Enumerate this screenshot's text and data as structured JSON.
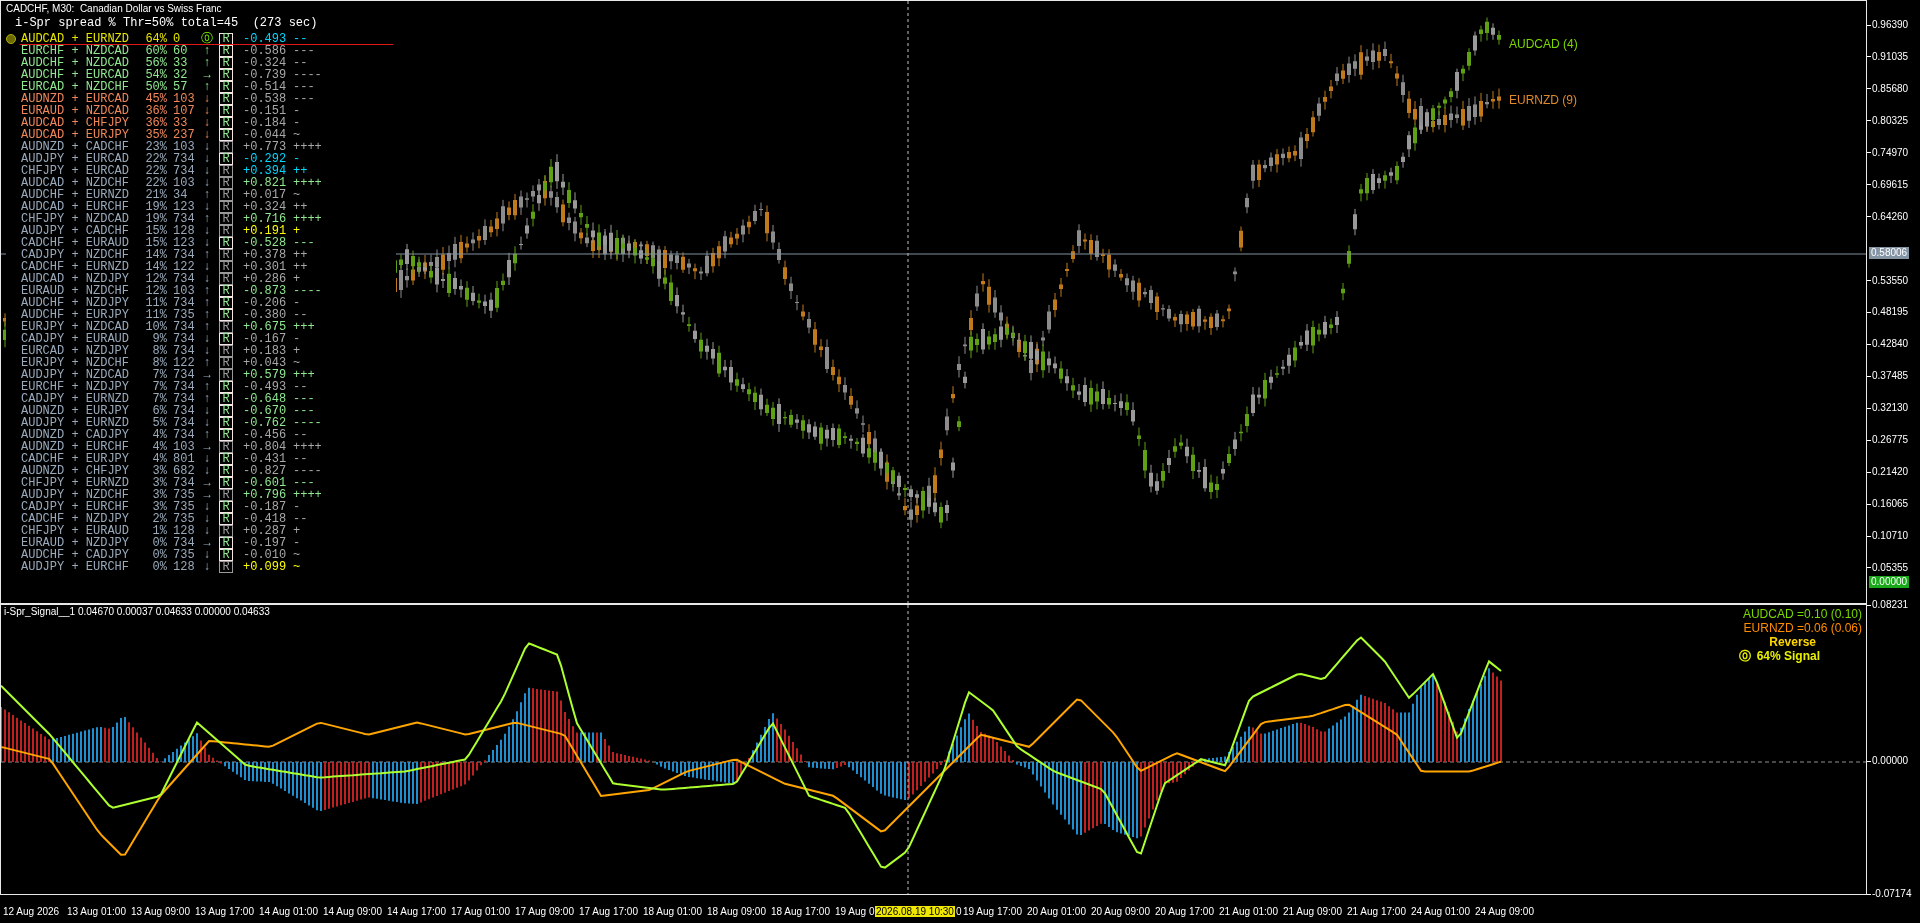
{
  "chart_title": "CADCHF, M30:  Canadian Dollar vs Swiss Franc",
  "panel_heading": "i-Spr spread % Thr=50% total=45  (273 sec)",
  "pairs": [
    {
      "pair": "AUDCAD + EURNZD",
      "percent": "64%",
      "count": "0",
      "direction": "⓪",
      "flag": "R",
      "flag_active": true,
      "value": {
        "text": "-0.493",
        "color": "#00d8ff"
      },
      "trend": "--",
      "color": "#e6e600",
      "selected": true
    },
    {
      "pair": "EURCHF + NZDCAD",
      "percent": "60%",
      "count": "60",
      "direction": "↑",
      "flag": "R",
      "flag_active": true,
      "value": {
        "text": "-0.586",
        "color": "#a8a8a8"
      },
      "trend": "---",
      "color": "#90e890",
      "selected": false
    },
    {
      "pair": "AUDCHF + NZDCAD",
      "percent": "56%",
      "count": "33",
      "direction": "↑",
      "flag": "R",
      "flag_active": true,
      "value": {
        "text": "-0.324",
        "color": "#a8a8a8"
      },
      "trend": "--",
      "color": "#90e890",
      "selected": false
    },
    {
      "pair": "AUDCHF + EURCAD",
      "percent": "54%",
      "count": "32",
      "direction": "→",
      "flag": "R",
      "flag_active": true,
      "value": {
        "text": "-0.739",
        "color": "#a8a8a8"
      },
      "trend": "----",
      "color": "#90e890",
      "selected": false
    },
    {
      "pair": "EURCAD + NZDCHF",
      "percent": "50%",
      "count": "57",
      "direction": "↑",
      "flag": "R",
      "flag_active": true,
      "value": {
        "text": "-0.514",
        "color": "#a8a8a8"
      },
      "trend": "---",
      "color": "#90e890",
      "selected": false
    },
    {
      "pair": "AUDNZD + EURCAD",
      "percent": "45%",
      "count": "103",
      "direction": "↓",
      "flag": "R",
      "flag_active": true,
      "value": {
        "text": "-0.538",
        "color": "#a8a8a8"
      },
      "trend": "---",
      "color": "#f0875a",
      "selected": false
    },
    {
      "pair": "EURAUD + NZDCAD",
      "percent": "36%",
      "count": "107",
      "direction": "↓",
      "flag": "R",
      "flag_active": true,
      "value": {
        "text": "-0.151",
        "color": "#a8a8a8"
      },
      "trend": "-",
      "color": "#f0875a",
      "selected": false
    },
    {
      "pair": "AUDCAD + CHFJPY",
      "percent": "36%",
      "count": "33",
      "direction": "↓",
      "flag": "R",
      "flag_active": true,
      "value": {
        "text": "-0.184",
        "color": "#a8a8a8"
      },
      "trend": "-",
      "color": "#f0875a",
      "selected": false
    },
    {
      "pair": "AUDCAD + EURJPY",
      "percent": "35%",
      "count": "237",
      "direction": "↓",
      "flag": "R",
      "flag_active": true,
      "value": {
        "text": "-0.044",
        "color": "#a8a8a8"
      },
      "trend": "~",
      "color": "#f0875a",
      "selected": false
    },
    {
      "pair": "AUDNZD + CADCHF",
      "percent": "23%",
      "count": "103",
      "direction": "↓",
      "flag": "R",
      "flag_active": false,
      "value": {
        "text": "+0.773",
        "color": "#a8a8a8"
      },
      "trend": "++++",
      "color": "#9aaabb",
      "selected": false
    },
    {
      "pair": "AUDJPY + EURCAD",
      "percent": "22%",
      "count": "734",
      "direction": "↓",
      "flag": "R",
      "flag_active": true,
      "value": {
        "text": "-0.292",
        "color": "#00d8ff"
      },
      "trend": "-",
      "color": "#9aaabb",
      "selected": false
    },
    {
      "pair": "CHFJPY + EURCAD",
      "percent": "22%",
      "count": "734",
      "direction": "↓",
      "flag": "R",
      "flag_active": false,
      "value": {
        "text": "+0.394",
        "color": "#00d8ff"
      },
      "trend": "++",
      "color": "#9aaabb",
      "selected": false
    },
    {
      "pair": "AUDCAD + NZDCHF",
      "percent": "22%",
      "count": "103",
      "direction": "↓",
      "flag": "R",
      "flag_active": false,
      "value": {
        "text": "+0.821",
        "color": "#90e890"
      },
      "trend": "++++",
      "color": "#9aaabb",
      "selected": false
    },
    {
      "pair": "AUDCHF + EURNZD",
      "percent": "21%",
      "count": "34",
      "direction": "↑",
      "flag": "R",
      "flag_active": false,
      "value": {
        "text": "+0.017",
        "color": "#a8a8a8"
      },
      "trend": "~",
      "color": "#9aaabb",
      "selected": false
    },
    {
      "pair": "AUDCAD + EURCHF",
      "percent": "19%",
      "count": "123",
      "direction": "↓",
      "flag": "R",
      "flag_active": false,
      "value": {
        "text": "+0.324",
        "color": "#a8a8a8"
      },
      "trend": "++",
      "color": "#9aaabb",
      "selected": false
    },
    {
      "pair": "CHFJPY + NZDCAD",
      "percent": "19%",
      "count": "734",
      "direction": "↑",
      "flag": "R",
      "flag_active": false,
      "value": {
        "text": "+0.716",
        "color": "#90e890"
      },
      "trend": "++++",
      "color": "#9aaabb",
      "selected": false
    },
    {
      "pair": "AUDJPY + CADCHF",
      "percent": "15%",
      "count": "128",
      "direction": "↓",
      "flag": "R",
      "flag_active": false,
      "value": {
        "text": "+0.191",
        "color": "#ffff00"
      },
      "trend": "+",
      "color": "#9aaabb",
      "selected": false
    },
    {
      "pair": "CADCHF + EURAUD",
      "percent": "15%",
      "count": "123",
      "direction": "↓",
      "flag": "R",
      "flag_active": true,
      "value": {
        "text": "-0.528",
        "color": "#90e890"
      },
      "trend": "---",
      "color": "#9aaabb",
      "selected": false
    },
    {
      "pair": "CADJPY + NZDCHF",
      "percent": "14%",
      "count": "734",
      "direction": "↑",
      "flag": "R",
      "flag_active": false,
      "value": {
        "text": "+0.378",
        "color": "#a8a8a8"
      },
      "trend": "++",
      "color": "#9aaabb",
      "selected": false
    },
    {
      "pair": "CADCHF + EURNZD",
      "percent": "14%",
      "count": "122",
      "direction": "↓",
      "flag": "R",
      "flag_active": false,
      "value": {
        "text": "+0.301",
        "color": "#a8a8a8"
      },
      "trend": "++",
      "color": "#9aaabb",
      "selected": false
    },
    {
      "pair": "AUDCAD + NZDJPY",
      "percent": "12%",
      "count": "734",
      "direction": "↓",
      "flag": "R",
      "flag_active": false,
      "value": {
        "text": "+0.286",
        "color": "#a8a8a8"
      },
      "trend": "+",
      "color": "#9aaabb",
      "selected": false
    },
    {
      "pair": "EURAUD + NZDCHF",
      "percent": "12%",
      "count": "103",
      "direction": "↑",
      "flag": "R",
      "flag_active": true,
      "value": {
        "text": "-0.873",
        "color": "#90e890"
      },
      "trend": "----",
      "color": "#9aaabb",
      "selected": false
    },
    {
      "pair": "AUDCHF + NZDJPY",
      "percent": "11%",
      "count": "734",
      "direction": "↑",
      "flag": "R",
      "flag_active": true,
      "value": {
        "text": "-0.206",
        "color": "#a8a8a8"
      },
      "trend": "-",
      "color": "#9aaabb",
      "selected": false
    },
    {
      "pair": "AUDCHF + EURJPY",
      "percent": "11%",
      "count": "735",
      "direction": "↑",
      "flag": "R",
      "flag_active": true,
      "value": {
        "text": "-0.380",
        "color": "#a8a8a8"
      },
      "trend": "--",
      "color": "#9aaabb",
      "selected": false
    },
    {
      "pair": "EURJPY + NZDCAD",
      "percent": "10%",
      "count": "734",
      "direction": "↑",
      "flag": "R",
      "flag_active": false,
      "value": {
        "text": "+0.675",
        "color": "#90e890"
      },
      "trend": "+++",
      "color": "#9aaabb",
      "selected": false
    },
    {
      "pair": "CADJPY + EURAUD",
      "percent": "9%",
      "count": "734",
      "direction": "↓",
      "flag": "R",
      "flag_active": true,
      "value": {
        "text": "-0.167",
        "color": "#a8a8a8"
      },
      "trend": "-",
      "color": "#9aaabb",
      "selected": false
    },
    {
      "pair": "EURCAD + NZDJPY",
      "percent": "8%",
      "count": "734",
      "direction": "↓",
      "flag": "R",
      "flag_active": false,
      "value": {
        "text": "+0.183",
        "color": "#a8a8a8"
      },
      "trend": "+",
      "color": "#9aaabb",
      "selected": false
    },
    {
      "pair": "EURJPY + NZDCHF",
      "percent": "8%",
      "count": "122",
      "direction": "↑",
      "flag": "R",
      "flag_active": false,
      "value": {
        "text": "+0.043",
        "color": "#a8a8a8"
      },
      "trend": "~",
      "color": "#9aaabb",
      "selected": false
    },
    {
      "pair": "AUDJPY + NZDCAD",
      "percent": "7%",
      "count": "734",
      "direction": "→",
      "flag": "R",
      "flag_active": false,
      "value": {
        "text": "+0.579",
        "color": "#90e890"
      },
      "trend": "+++",
      "color": "#9aaabb",
      "selected": false
    },
    {
      "pair": "EURCHF + NZDJPY",
      "percent": "7%",
      "count": "734",
      "direction": "↑",
      "flag": "R",
      "flag_active": true,
      "value": {
        "text": "-0.493",
        "color": "#a8a8a8"
      },
      "trend": "--",
      "color": "#9aaabb",
      "selected": false
    },
    {
      "pair": "CADJPY + EURNZD",
      "percent": "7%",
      "count": "734",
      "direction": "↑",
      "flag": "R",
      "flag_active": true,
      "value": {
        "text": "-0.648",
        "color": "#90e890"
      },
      "trend": "---",
      "color": "#9aaabb",
      "selected": false
    },
    {
      "pair": "AUDNZD + EURJPY",
      "percent": "6%",
      "count": "734",
      "direction": "↓",
      "flag": "R",
      "flag_active": true,
      "value": {
        "text": "-0.670",
        "color": "#90e890"
      },
      "trend": "---",
      "color": "#9aaabb",
      "selected": false
    },
    {
      "pair": "AUDJPY + EURNZD",
      "percent": "5%",
      "count": "734",
      "direction": "↓",
      "flag": "R",
      "flag_active": true,
      "value": {
        "text": "-0.762",
        "color": "#90e890"
      },
      "trend": "----",
      "color": "#9aaabb",
      "selected": false
    },
    {
      "pair": "AUDNZD + CADJPY",
      "percent": "4%",
      "count": "734",
      "direction": "↑",
      "flag": "R",
      "flag_active": true,
      "value": {
        "text": "-0.456",
        "color": "#a8a8a8"
      },
      "trend": "--",
      "color": "#9aaabb",
      "selected": false
    },
    {
      "pair": "AUDNZD + EURCHF",
      "percent": "4%",
      "count": "103",
      "direction": "→",
      "flag": "R",
      "flag_active": false,
      "value": {
        "text": "+0.804",
        "color": "#a8a8a8"
      },
      "trend": "++++",
      "color": "#9aaabb",
      "selected": false
    },
    {
      "pair": "CADCHF + EURJPY",
      "percent": "4%",
      "count": "801",
      "direction": "↓",
      "flag": "R",
      "flag_active": true,
      "value": {
        "text": "-0.431",
        "color": "#a8a8a8"
      },
      "trend": "--",
      "color": "#9aaabb",
      "selected": false
    },
    {
      "pair": "AUDNZD + CHFJPY",
      "percent": "3%",
      "count": "682",
      "direction": "↓",
      "flag": "R",
      "flag_active": true,
      "value": {
        "text": "-0.827",
        "color": "#a8a8a8"
      },
      "trend": "----",
      "color": "#9aaabb",
      "selected": false
    },
    {
      "pair": "CHFJPY + EURNZD",
      "percent": "3%",
      "count": "734",
      "direction": "→",
      "flag": "R",
      "flag_active": true,
      "value": {
        "text": "-0.601",
        "color": "#90e890"
      },
      "trend": "---",
      "color": "#9aaabb",
      "selected": false
    },
    {
      "pair": "AUDJPY + NZDCHF",
      "percent": "3%",
      "count": "735",
      "direction": "→",
      "flag": "R",
      "flag_active": false,
      "value": {
        "text": "+0.796",
        "color": "#90e890"
      },
      "trend": "++++",
      "color": "#9aaabb",
      "selected": false
    },
    {
      "pair": "CADJPY + EURCHF",
      "percent": "3%",
      "count": "735",
      "direction": "↓",
      "flag": "R",
      "flag_active": true,
      "value": {
        "text": "-0.187",
        "color": "#a8a8a8"
      },
      "trend": "-",
      "color": "#9aaabb",
      "selected": false
    },
    {
      "pair": "CADCHF + NZDJPY",
      "percent": "2%",
      "count": "735",
      "direction": "↓",
      "flag": "R",
      "flag_active": true,
      "value": {
        "text": "-0.418",
        "color": "#a8a8a8"
      },
      "trend": "--",
      "color": "#9aaabb",
      "selected": false
    },
    {
      "pair": "CHFJPY + EURAUD",
      "percent": "1%",
      "count": "128",
      "direction": "↓",
      "flag": "R",
      "flag_active": false,
      "value": {
        "text": "+0.287",
        "color": "#a8a8a8"
      },
      "trend": "+",
      "color": "#9aaabb",
      "selected": false
    },
    {
      "pair": "EURAUD + NZDJPY",
      "percent": "0%",
      "count": "734",
      "direction": "→",
      "flag": "R",
      "flag_active": true,
      "value": {
        "text": "-0.197",
        "color": "#a8a8a8"
      },
      "trend": "-",
      "color": "#9aaabb",
      "selected": false
    },
    {
      "pair": "AUDCHF + CADJPY",
      "percent": "0%",
      "count": "735",
      "direction": "↓",
      "flag": "R",
      "flag_active": true,
      "value": {
        "text": "-0.010",
        "color": "#a8a8a8"
      },
      "trend": "~",
      "color": "#9aaabb",
      "selected": false
    },
    {
      "pair": "AUDJPY + EURCHF",
      "percent": "0%",
      "count": "128",
      "direction": "↓",
      "flag": "R",
      "flag_active": false,
      "value": {
        "text": "+0.099",
        "color": "#ffff00"
      },
      "trend": "~",
      "color": "#9aaabb",
      "selected": false
    }
  ],
  "series_labels": [
    {
      "text": "AUDCAD (4)",
      "color": "#7ad800"
    },
    {
      "text": "EURNZD (9)",
      "color": "#e0892a"
    }
  ],
  "price_axis": [
    "0.96390",
    "0.91035",
    "0.85680",
    "0.80325",
    "0.74970",
    "0.69615",
    "0.64260",
    "0.53550",
    "0.48195",
    "0.42840",
    "0.37485",
    "0.32130",
    "0.26775",
    "0.21420",
    "0.16065",
    "0.10710",
    "0.05355"
  ],
  "crosshair_price": "0.58006",
  "zero_badge": "0.00000",
  "indicator": {
    "heading": "i-Spr_Signal__1 0.04670 0.00037 0.04633 0.00000 0.04633",
    "legend": [
      {
        "text": "AUDCAD =0.10 (0.10)",
        "color": "#7ad800"
      },
      {
        "text": "EURNZD =0.06 (0.06)",
        "color": "#ff8c00"
      }
    ],
    "mode": "Reverse",
    "signal_icon": "⓪",
    "signal": "64% Signal",
    "axis": [
      "0.08231",
      "0.00000",
      "-0.07174"
    ]
  },
  "time_axis": [
    "12 Aug 2026",
    "13 Aug 01:00",
    "13 Aug 09:00",
    "13 Aug 17:00",
    "14 Aug 01:00",
    "14 Aug 09:00",
    "14 Aug 17:00",
    "17 Aug 01:00",
    "17 Aug 09:00",
    "17 Aug 17:00",
    "18 Aug 01:00",
    "18 Aug 09:00",
    "18 Aug 17:00",
    "19 Aug 0",
    "0",
    "19 Aug 17:00",
    "20 Aug 01:00",
    "20 Aug 09:00",
    "20 Aug 17:00",
    "21 Aug 01:00",
    "21 Aug 09:00",
    "21 Aug 17:00",
    "24 Aug 01:00",
    "24 Aug 09:00"
  ],
  "crosshair_time": "2026.08.19 10:30"
}
